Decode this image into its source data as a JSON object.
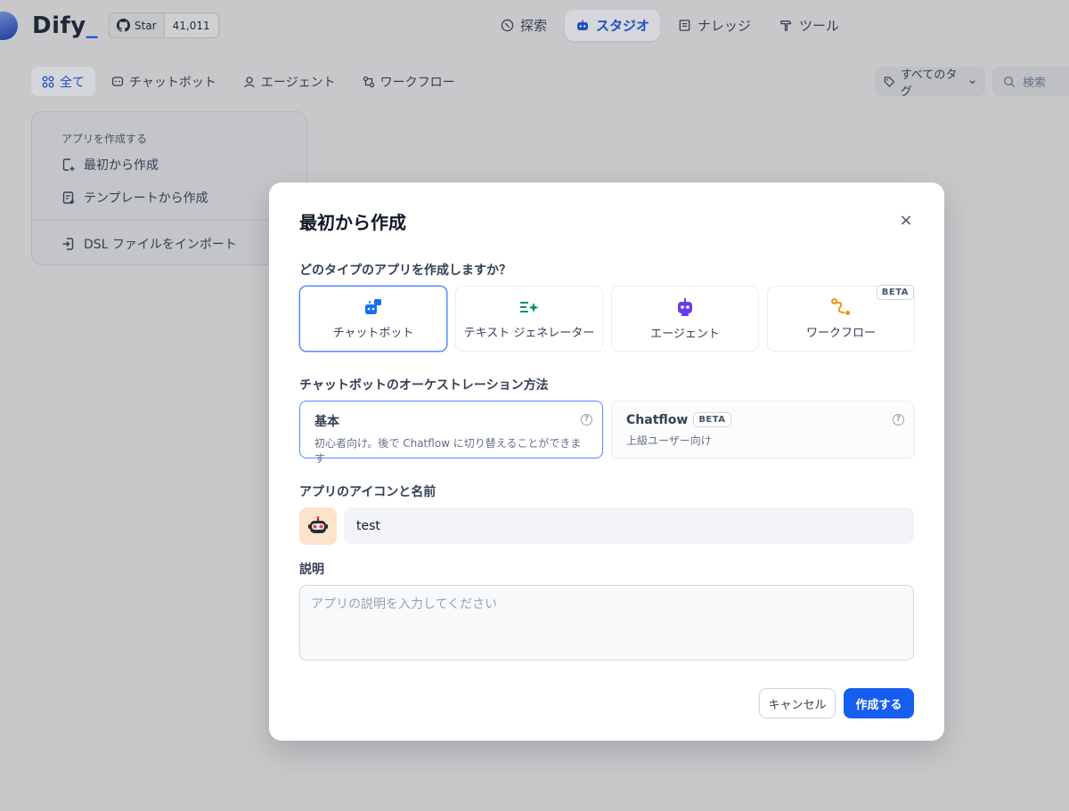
{
  "brand": {
    "name": "Dify",
    "underscore": "_"
  },
  "github": {
    "star_label": "Star",
    "star_count": "41,011"
  },
  "main_nav": {
    "explore": "探索",
    "studio": "スタジオ",
    "knowledge": "ナレッジ",
    "tools": "ツール",
    "active": "studio"
  },
  "filter_tabs": {
    "all": "全て",
    "chatbot": "チャットボット",
    "agent": "エージェント",
    "workflow": "ワークフロー",
    "active": "all"
  },
  "tag_filter": {
    "label": "すべてのタグ"
  },
  "search": {
    "placeholder": "検索"
  },
  "create_card": {
    "title": "アプリを作成する",
    "from_scratch": "最初から作成",
    "from_template": "テンプレートから作成",
    "import_dsl": "DSL ファイルをインポート"
  },
  "modal": {
    "title": "最初から作成",
    "type_question": "どのタイプのアプリを作成しますか？",
    "types": [
      {
        "label": "チャットボット",
        "icon": "chatbot-icon",
        "color": "#1570ef"
      },
      {
        "label": "テキスト ジェネレーター",
        "icon": "text-generator-icon",
        "color": "#079455"
      },
      {
        "label": "エージェント",
        "icon": "agent-icon",
        "color": "#6938ef"
      },
      {
        "label": "ワークフロー",
        "icon": "workflow-icon",
        "color": "#f79009",
        "badge": "BETA"
      }
    ],
    "selected_type": "チャットボット",
    "orchestration_label": "チャットボットのオーケストレーション方法",
    "orchestration": {
      "basic": {
        "title": "基本",
        "desc": "初心者向け。後で Chatflow に切り替えることができます"
      },
      "chatflow": {
        "title": "Chatflow",
        "badge": "BETA",
        "desc": "上級ユーザー向け"
      },
      "help_glyph": "?"
    },
    "icon_name_label": "アプリのアイコンと名前",
    "app_icon": "robot-emoji-icon",
    "app_name_value": "test",
    "description_label": "説明",
    "description_placeholder": "アプリの説明を入力してください",
    "cancel_label": "キャンセル",
    "create_label": "作成する",
    "close_glyph": "×"
  },
  "colors": {
    "accent": "#155eef",
    "selected_border": "#528bff",
    "overlay": "#c8c8ca",
    "icon_bg": "#fde3cc"
  }
}
